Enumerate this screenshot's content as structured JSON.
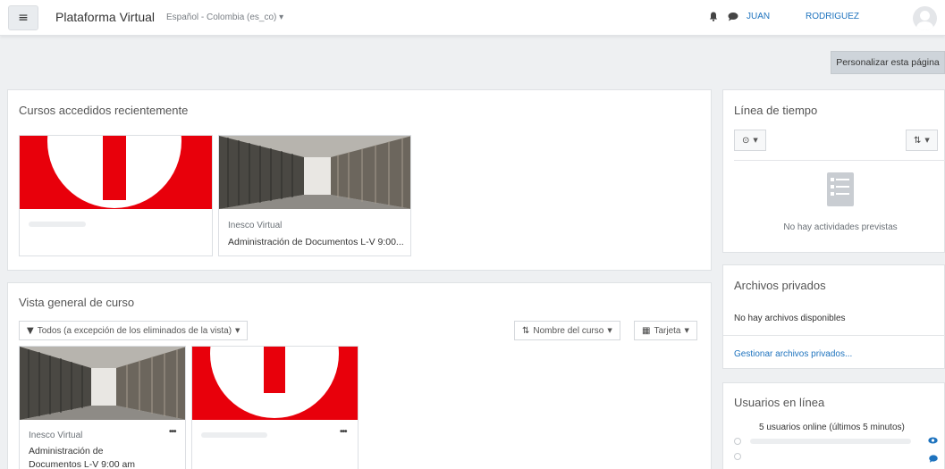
{
  "navbar": {
    "menu_icon": "hamburger-icon",
    "brand": "Plataforma Virtual",
    "language": "Español - Colombia (es_co) ▾",
    "user_first": "JUAN",
    "user_last": "RODRIGUEZ",
    "notification_icon": "bell-icon",
    "message_icon": "chat-icon"
  },
  "page": {
    "customize_button": "Personalizar esta página"
  },
  "recent_courses": {
    "title": "Cursos accedidos recientemente",
    "courses": [
      {
        "category": "",
        "name": "",
        "image": "red-logo"
      },
      {
        "category": "Inesco Virtual",
        "name": "Administración de Documentos L-V 9:00...",
        "image": "archive-shelves"
      }
    ]
  },
  "course_overview": {
    "title": "Vista general de curso",
    "filter_label": "Todos (a excepción de los eliminados de la vista)",
    "sort_label": "Nombre del curso",
    "view_label": "Tarjeta",
    "courses": [
      {
        "category": "Inesco Virtual",
        "name_line1": "Administración de",
        "name_line2": "Documentos L-V 9:00 am",
        "image": "archive-shelves",
        "menu": "•••"
      },
      {
        "category": "",
        "name_line1": "",
        "name_line2": "",
        "image": "red-logo",
        "menu": "•••"
      }
    ]
  },
  "timeline": {
    "title": "Línea de tiempo",
    "empty_text": "No hay actividades previstas"
  },
  "private_files": {
    "title": "Archivos privados",
    "empty_text": "No hay archivos disponibles",
    "manage_link": "Gestionar archivos privados..."
  },
  "online_users": {
    "title": "Usuarios en línea",
    "summary": "5 usuarios online (últimos 5 minutos)"
  },
  "colors": {
    "accent": "#1e73be",
    "logo_red": "#e8000b",
    "page_bg": "#eef0f2"
  }
}
